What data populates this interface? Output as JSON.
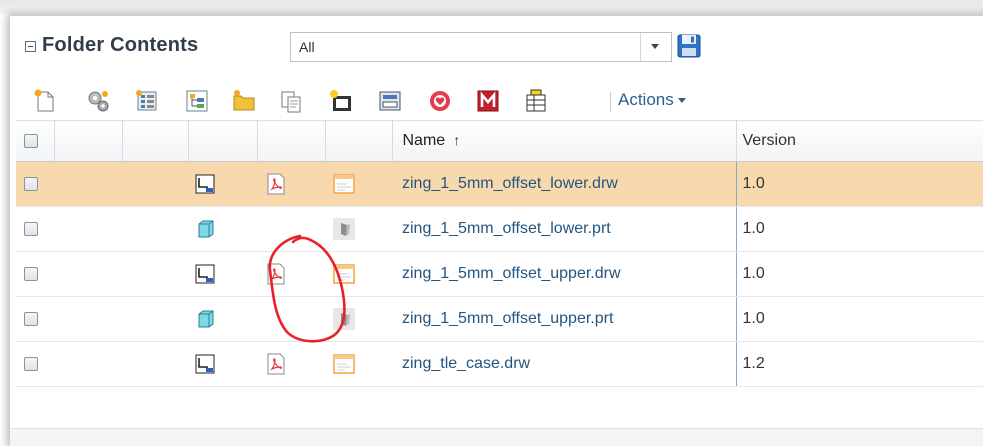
{
  "panel": {
    "title": "Folder Contents",
    "filter": {
      "selected": "All"
    }
  },
  "toolbar": {
    "buttons": [
      "new-document-icon",
      "gear-settings-icon",
      "checklist-icon",
      "structure-icon",
      "folder-star-icon",
      "copy-icon",
      "new-folder-icon",
      "drawer-icon",
      "heart-badge-icon",
      "m-badge-icon",
      "table-pin-icon"
    ],
    "actions_label": "Actions"
  },
  "table": {
    "columns": {
      "name": "Name",
      "sort_indicator": "↑",
      "version": "Version"
    },
    "rows": [
      {
        "type_icon": "drawing-icon",
        "pdf": true,
        "thumb": "drawing-thumbnail-icon",
        "name": "zing_1_5mm_offset_lower.drw",
        "version": "1.0",
        "selected": true
      },
      {
        "type_icon": "part-icon",
        "pdf": false,
        "thumb": "part-thumbnail-icon",
        "name": "zing_1_5mm_offset_lower.prt",
        "version": "1.0",
        "selected": false
      },
      {
        "type_icon": "drawing-icon",
        "pdf": true,
        "thumb": "drawing-thumbnail-icon",
        "name": "zing_1_5mm_offset_upper.drw",
        "version": "1.0",
        "selected": false
      },
      {
        "type_icon": "part-icon",
        "pdf": false,
        "thumb": "part-thumbnail-icon",
        "name": "zing_1_5mm_offset_upper.prt",
        "version": "1.0",
        "selected": false
      },
      {
        "type_icon": "drawing-icon",
        "pdf": true,
        "thumb": "drawing-thumbnail-icon",
        "name": "zing_tle_case.drw",
        "version": "1.2",
        "selected": false
      }
    ]
  },
  "colors": {
    "selected_row": "#f8d9ad",
    "link_text": "#24557f",
    "annotation": "#e8212b"
  }
}
